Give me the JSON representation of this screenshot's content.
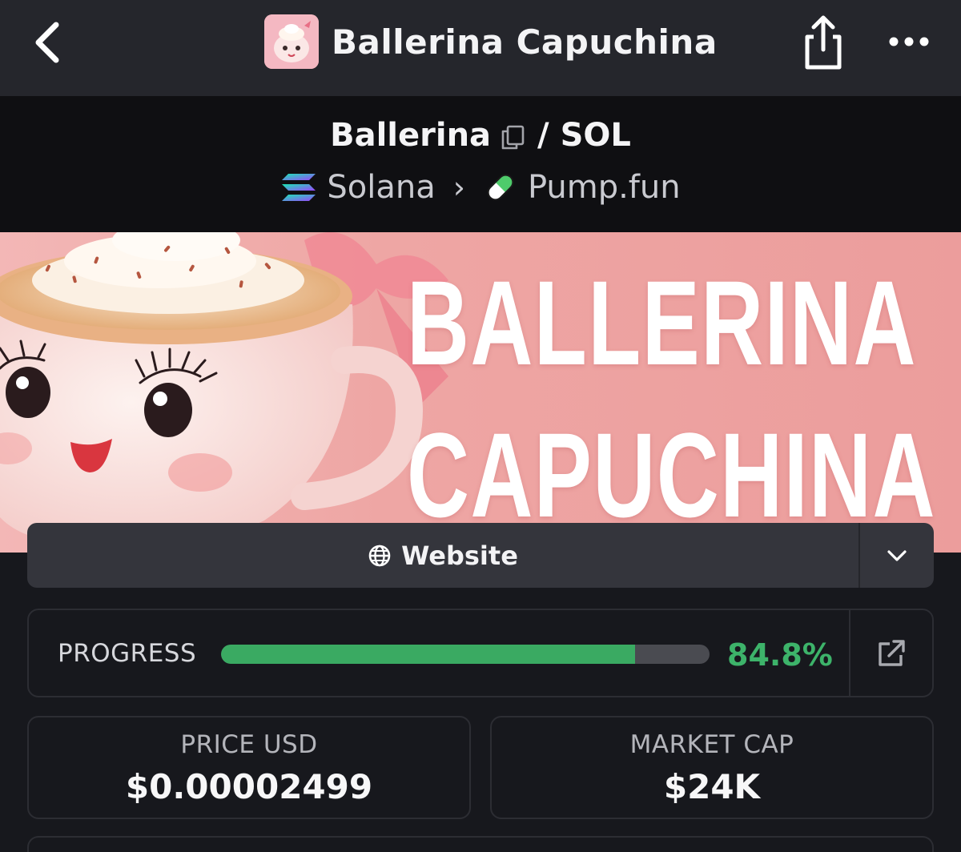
{
  "header": {
    "title": "Ballerina Capuchina",
    "back_icon": "chevron-left-icon",
    "share_icon": "share-icon",
    "more_icon": "more-horizontal-icon"
  },
  "pair": {
    "base": "Ballerina",
    "separator": "/ SOL",
    "chain": "Solana",
    "platform": "Pump.fun"
  },
  "banner": {
    "line1": "BALLERINA",
    "line2": "CAPUCHINA"
  },
  "website": {
    "label": "Website",
    "icon": "globe-icon"
  },
  "progress": {
    "label": "PROGRESS",
    "value_text": "84.8%",
    "fraction": 0.848
  },
  "stats": {
    "price_label": "PRICE USD",
    "price_value": "$0.00002499",
    "mcap_label": "MARKET CAP",
    "mcap_value": "$24K"
  },
  "colors": {
    "accent_green": "#3db36a",
    "background": "#17181d",
    "banner_pink": "#ee a6a4"
  }
}
